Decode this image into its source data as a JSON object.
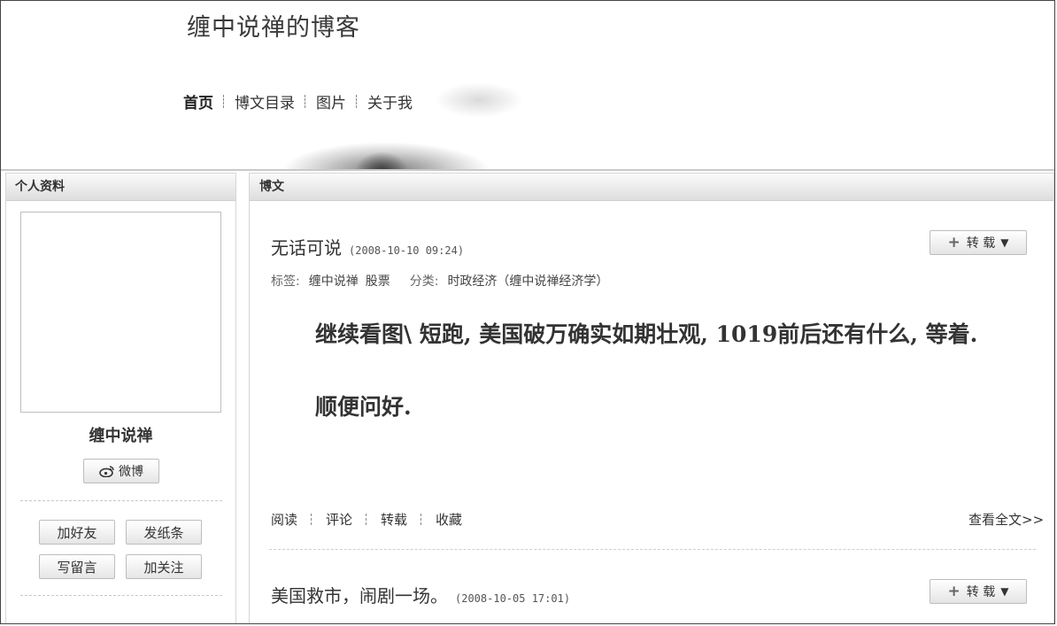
{
  "header": {
    "blog_title": "缠中说禅的博客",
    "nav": [
      {
        "label": "首页",
        "active": true
      },
      {
        "label": "博文目录",
        "active": false
      },
      {
        "label": "图片",
        "active": false
      },
      {
        "label": "关于我",
        "active": false
      }
    ]
  },
  "sidebar": {
    "title": "个人资料",
    "username": "缠中说禅",
    "weibo_label": "微博",
    "actions": {
      "add_friend": "加好友",
      "send_note": "发纸条",
      "write_message": "写留言",
      "follow": "加关注"
    }
  },
  "main": {
    "title": "博文",
    "posts": [
      {
        "title": "无话可说",
        "time": "(2008-10-10 09:24)",
        "repost_label": "转 载",
        "tags_label": "标签:",
        "tags": [
          "缠中说禅",
          "股票"
        ],
        "category_label": "分类:",
        "category": "时政经济（缠中说禅经济学）",
        "paragraphs": [
          "继续看图\\ 短跑, 美国破万确实如期壮观, 1019前后还有什么, 等着.",
          "顺便问好."
        ],
        "actions": [
          "阅读",
          "评论",
          "转载",
          "收藏"
        ],
        "read_more": "查看全文>>"
      },
      {
        "title": "美国救市，闹剧一场。",
        "time": "(2008-10-05 17:01)",
        "repost_label": "转 载"
      }
    ]
  }
}
